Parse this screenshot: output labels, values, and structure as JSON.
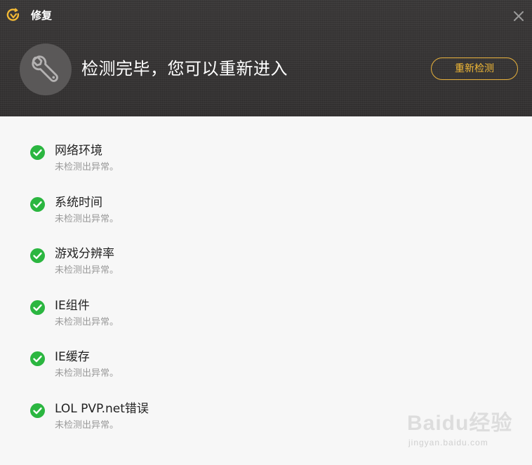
{
  "window": {
    "title": "修复"
  },
  "header": {
    "status_title": "检测完毕，您可以重新进入",
    "recheck_label": "重新检测",
    "accent_color": "#f2b936"
  },
  "checks": [
    {
      "name": "网络环境",
      "status": "未检测出异常。",
      "state": "ok"
    },
    {
      "name": "系统时间",
      "status": "未检测出异常。",
      "state": "ok"
    },
    {
      "name": "游戏分辨率",
      "status": "未检测出异常。",
      "state": "ok"
    },
    {
      "name": "IE组件",
      "status": "未检测出异常。",
      "state": "ok"
    },
    {
      "name": "IE缓存",
      "status": "未检测出异常。",
      "state": "ok"
    },
    {
      "name": "LOL PVP.net错误",
      "status": "未检测出异常。",
      "state": "ok"
    }
  ],
  "icons": {
    "logo": "app-logo-icon",
    "close": "close-icon",
    "wrench": "wrench-icon",
    "check": "check-circle-icon"
  },
  "colors": {
    "ok_green": "#2bb640",
    "header_bg": "#3b3939"
  },
  "watermark": {
    "brand": "Baidu经验",
    "url": "jingyan.baidu.com"
  }
}
